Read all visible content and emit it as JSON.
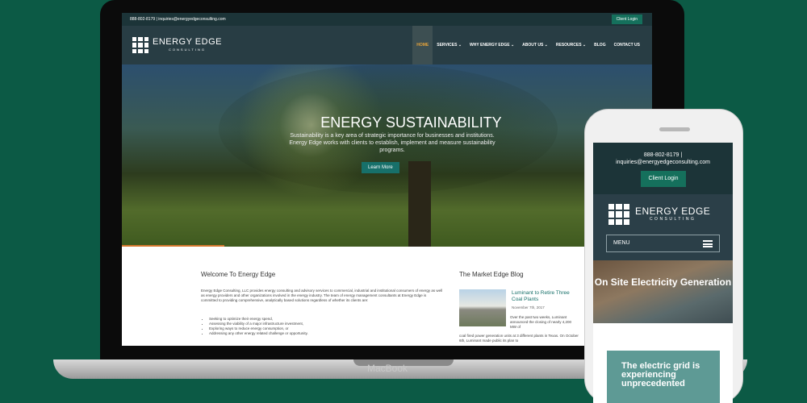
{
  "laptop": {
    "brand": "MacBook"
  },
  "site": {
    "topbar": {
      "contact": "888-802-8179  |  inquiries@energyedgeconsulting.com",
      "client_login": "Client Login"
    },
    "logo": {
      "line1": "ENERGY EDGE",
      "line2": "CONSULTING"
    },
    "menu": [
      {
        "label": "HOME",
        "active": true
      },
      {
        "label": "SERVICES ⌄",
        "active": false
      },
      {
        "label": "WHY ENERGY EDGE ⌄",
        "active": false
      },
      {
        "label": "ABOUT US ⌄",
        "active": false
      },
      {
        "label": "RESOURCES ⌄",
        "active": false
      },
      {
        "label": "BLOG",
        "active": false
      },
      {
        "label": "CONTACT US",
        "active": false
      }
    ],
    "hero": {
      "title": "ENERGY SUSTAINABILITY",
      "text": "Sustainability is a key area of strategic importance for businesses and institutions. Energy Edge works with clients to establish, implement and measure sustainability programs.",
      "button": "Learn More"
    },
    "welcome": {
      "title": "Welcome To Energy Edge",
      "body": "Energy Edge Consulting, LLC provides energy consulting and advisory services to commercial, industrial and institutional consumers of energy as well as energy providers and other organizations involved in the energy industry.  The team of energy management consultants at Energy Edge is committed to providing comprehensive, analytically based solutions regardless of whether its clients are:",
      "bullets": [
        "Seeking to optimize their energy spend,",
        "Assessing the viability of a major infrastructure investment,",
        "Exploring ways to reduce energy consumption, or",
        "Addressing any other energy related challenge or opportunity."
      ]
    },
    "blog": {
      "title": "The Market Edge Blog",
      "post_title": "Luminant to Retire Three Coal Plants",
      "post_date": "November 7th, 2017",
      "excerpt_side": "Over the past two weeks, Luminant announced the closing of nearly 4,200 MW of",
      "excerpt_full": "coal fired power generation units at 3 different plants in Texas. On October 6th, Luminant made public its plan to"
    }
  },
  "mobile": {
    "contact_phone": "888-802-8179  |",
    "contact_email": "inquiries@energyedgeconsulting.com",
    "client_login": "Client Login",
    "logo_line1": "ENERGY EDGE",
    "logo_line2": "CONSULTING",
    "menu_label": "MENU",
    "hero_title": "On Site Electricity Generation",
    "card_title": "The electric grid is experiencing unprecedented"
  },
  "colors": {
    "background": "#0c5a45",
    "nav_dark": "#1c3438",
    "accent_teal": "#15705c",
    "accent_orange": "#d7792e"
  }
}
